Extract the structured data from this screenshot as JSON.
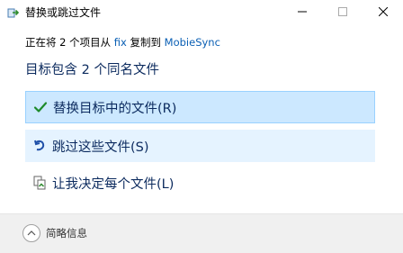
{
  "window": {
    "title": "替换或跳过文件"
  },
  "subtitle": {
    "prefix": "正在将 2 个项目从 ",
    "source": "fix",
    "middle": " 复制到 ",
    "destination": "MobieSync"
  },
  "heading": "目标包含 2 个同名文件",
  "options": [
    {
      "label": "替换目标中的文件(R)",
      "icon": "check-icon"
    },
    {
      "label": "跳过这些文件(S)",
      "icon": "skip-arrow-icon"
    },
    {
      "label": "让我决定每个文件(L)",
      "icon": "compare-files-icon"
    }
  ],
  "footer": {
    "details_label": "简略信息"
  },
  "colors": {
    "accent": "#0a5fb4",
    "option_text": "#0b2a5e",
    "selected_bg": "#cce8ff",
    "hover_bg": "#e5f3ff"
  }
}
